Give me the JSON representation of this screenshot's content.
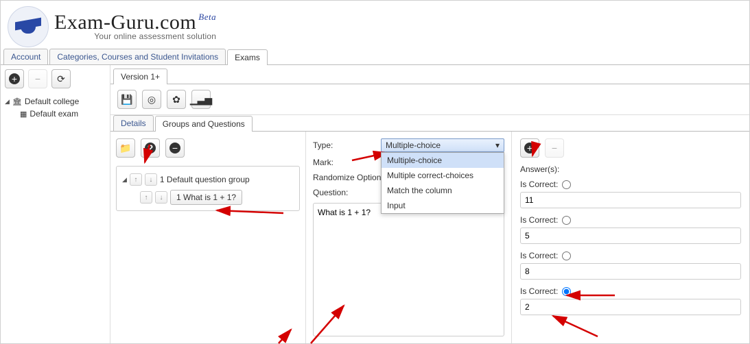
{
  "header": {
    "brand_main": "Exam-Guru.com",
    "brand_beta": "Beta",
    "brand_tagline": "Your online assessment solution"
  },
  "top_tabs": {
    "items": [
      {
        "label": "Account"
      },
      {
        "label": "Categories, Courses and Student Invitations"
      },
      {
        "label": "Exams"
      }
    ],
    "active_index": 2
  },
  "left_tree": {
    "root": {
      "label": "Default college"
    },
    "child": {
      "label": "Default exam"
    }
  },
  "version_tabs": {
    "items": [
      {
        "label": "Version 1+"
      }
    ],
    "active_index": 0
  },
  "inner_tabs": {
    "items": [
      {
        "label": "Details"
      },
      {
        "label": "Groups and Questions"
      }
    ],
    "active_index": 1
  },
  "groups": {
    "group_label": "1 Default question group",
    "question_label": "1 What is 1 + 1?"
  },
  "props": {
    "type_label": "Type:",
    "type_value": "Multiple-choice",
    "type_options": [
      "Multiple-choice",
      "Multiple correct-choices",
      "Match the column",
      "Input"
    ],
    "mark_label": "Mark:",
    "randomize_label": "Randomize Options:",
    "question_label": "Question:",
    "question_text": "What is 1 + 1?"
  },
  "answers": {
    "heading": "Answer(s):",
    "is_correct_label": "Is Correct:",
    "items": [
      {
        "value": "11",
        "correct": false
      },
      {
        "value": "5",
        "correct": false
      },
      {
        "value": "8",
        "correct": false
      },
      {
        "value": "2",
        "correct": true
      }
    ]
  },
  "icons": {
    "plus": "+",
    "minus": "−",
    "refresh": "⟳",
    "save": "💾",
    "target": "◎",
    "badge": "✿",
    "chart": "▁▃▅",
    "folder": "📁",
    "help": "?",
    "bank": "🏛",
    "grid": "▦",
    "caret_down": "▾",
    "caret_right": "▸",
    "arrow_up": "↑",
    "arrow_down": "↓"
  }
}
